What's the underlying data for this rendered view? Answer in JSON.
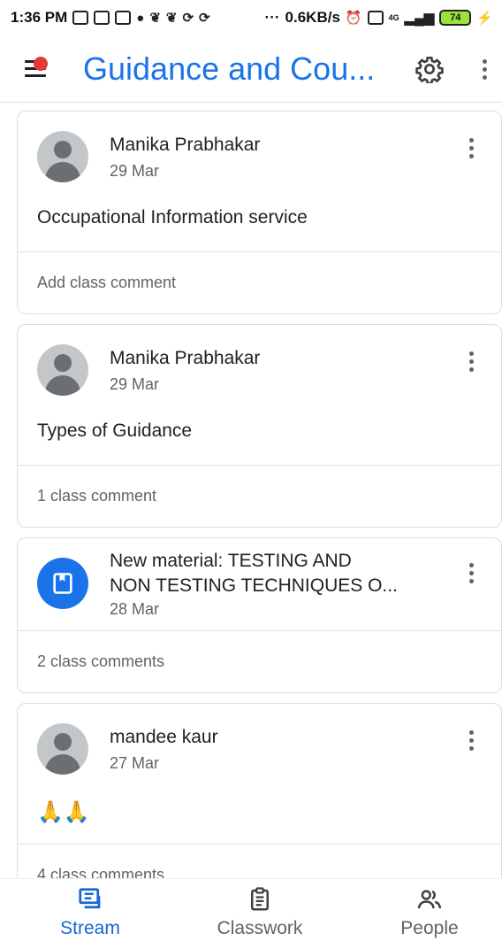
{
  "status_bar": {
    "time": "1:36 PM",
    "dots": "···",
    "speed": "0.6KB/s",
    "network": "4G",
    "battery": "74"
  },
  "app_bar": {
    "title": "Guidance and Cou..."
  },
  "colors": {
    "accent": "#1a73e8",
    "notification_dot": "#e53935",
    "active_nav": "#1967d2"
  },
  "stream": [
    {
      "type": "post",
      "author": "Manika Prabhakar",
      "date": "29 Mar",
      "text": "Occupational Information service",
      "footer": "Add class comment"
    },
    {
      "type": "post",
      "author": "Manika Prabhakar",
      "date": "29 Mar",
      "text": "Types of Guidance",
      "footer": "1 class comment"
    },
    {
      "type": "material",
      "title_line1": "New material: TESTING AND",
      "title_line2": "NON TESTING TECHNIQUES O...",
      "date": "28 Mar",
      "footer": "2 class comments"
    },
    {
      "type": "post",
      "author": "mandee kaur",
      "date": "27 Mar",
      "text": "🙏🙏",
      "footer": "4 class comments"
    }
  ],
  "bottom_nav": [
    {
      "label": "Stream",
      "icon": "stream-icon",
      "active": true
    },
    {
      "label": "Classwork",
      "icon": "classwork-icon",
      "active": false
    },
    {
      "label": "People",
      "icon": "people-icon",
      "active": false
    }
  ]
}
